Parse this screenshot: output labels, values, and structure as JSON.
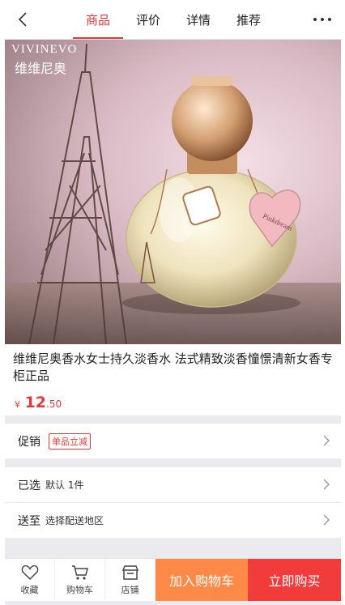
{
  "header": {
    "tabs": [
      {
        "label": "商品",
        "active": true
      },
      {
        "label": "评价",
        "active": false
      },
      {
        "label": "详情",
        "active": false
      },
      {
        "label": "推荐",
        "active": false
      }
    ]
  },
  "hero": {
    "brand_en": "VIVINEVO",
    "brand_cn": "维维尼奥",
    "tag_script": "Pinkdream"
  },
  "product": {
    "title": "维维尼奥香水女士持久淡香水 法式精致淡香憧憬清新女香专柜正品",
    "currency": "¥",
    "price_int": "12",
    "price_dec": ".50"
  },
  "rows": {
    "promo_label": "促销",
    "promo_tag": "单品立减",
    "selected_label": "已选",
    "selected_value": "默认 1件",
    "ship_label": "送至",
    "ship_value": "选择配送地区"
  },
  "bottom_bar": {
    "favorite": "收藏",
    "cart": "购物车",
    "shop": "店铺",
    "add_to_cart": "加入购物车",
    "buy_now": "立即购买"
  },
  "colors": {
    "accent": "#e4393c",
    "cart_button": "#ff8a47",
    "buy_button": "#f23c3c"
  }
}
